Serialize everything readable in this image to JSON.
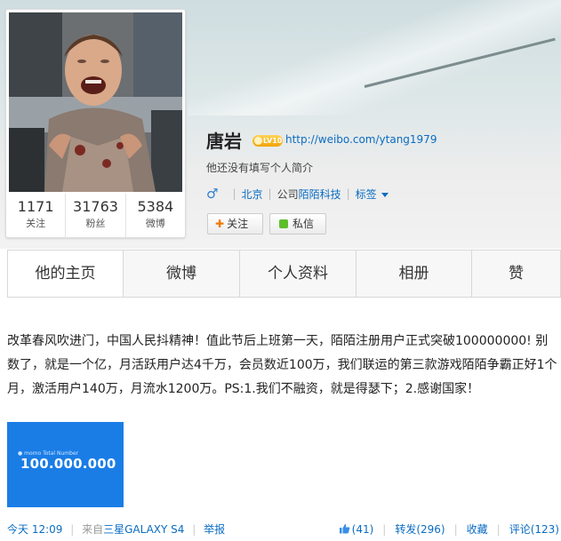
{
  "profile": {
    "name": "唐岩",
    "level": "LV10",
    "url": "http://weibo.com/ytang1979",
    "bio": "他还没有填写个人简介",
    "gender_icon": "♂",
    "location": "北京",
    "company_prefix": "公司",
    "company": "陌陌科技",
    "tags_label": "标签",
    "follow_label": "关注",
    "follow_plus": "✚",
    "message_label": "私信"
  },
  "stats": [
    {
      "value": "1171",
      "label": "关注"
    },
    {
      "value": "31763",
      "label": "粉丝"
    },
    {
      "value": "5384",
      "label": "微博"
    }
  ],
  "tabs": [
    {
      "label": "他的主页"
    },
    {
      "label": "微博"
    },
    {
      "label": "个人资料"
    },
    {
      "label": "相册"
    },
    {
      "label": "赞"
    }
  ],
  "post": {
    "text": "改革春风吹进门，中国人民抖精神！值此节后上班第一天，陌陌注册用户正式突破100000000! 别数了，就是一个亿，月活跃用户达4千万，会员数近100万，我们联运的第三款游戏陌陌争霸正好1个月，激活用户140万，月流水1200万。PS:1.我们不融资，就是得瑟下；2.感谢国家！",
    "image_brand": "● momo  Total Number",
    "image_number": "100.000.000",
    "time": "今天 12:09",
    "source_prefix": "来自",
    "source": "三星GALAXY S4",
    "report": "举报",
    "likes": "(41)",
    "repost": "转发(296)",
    "favorite": "收藏",
    "comment": "评论(123)"
  },
  "colors": {
    "link": "#0a6cc2",
    "level_badge": "#f2a300",
    "message_dot": "#5cbf2a",
    "image_bg": "#1a7de6"
  }
}
